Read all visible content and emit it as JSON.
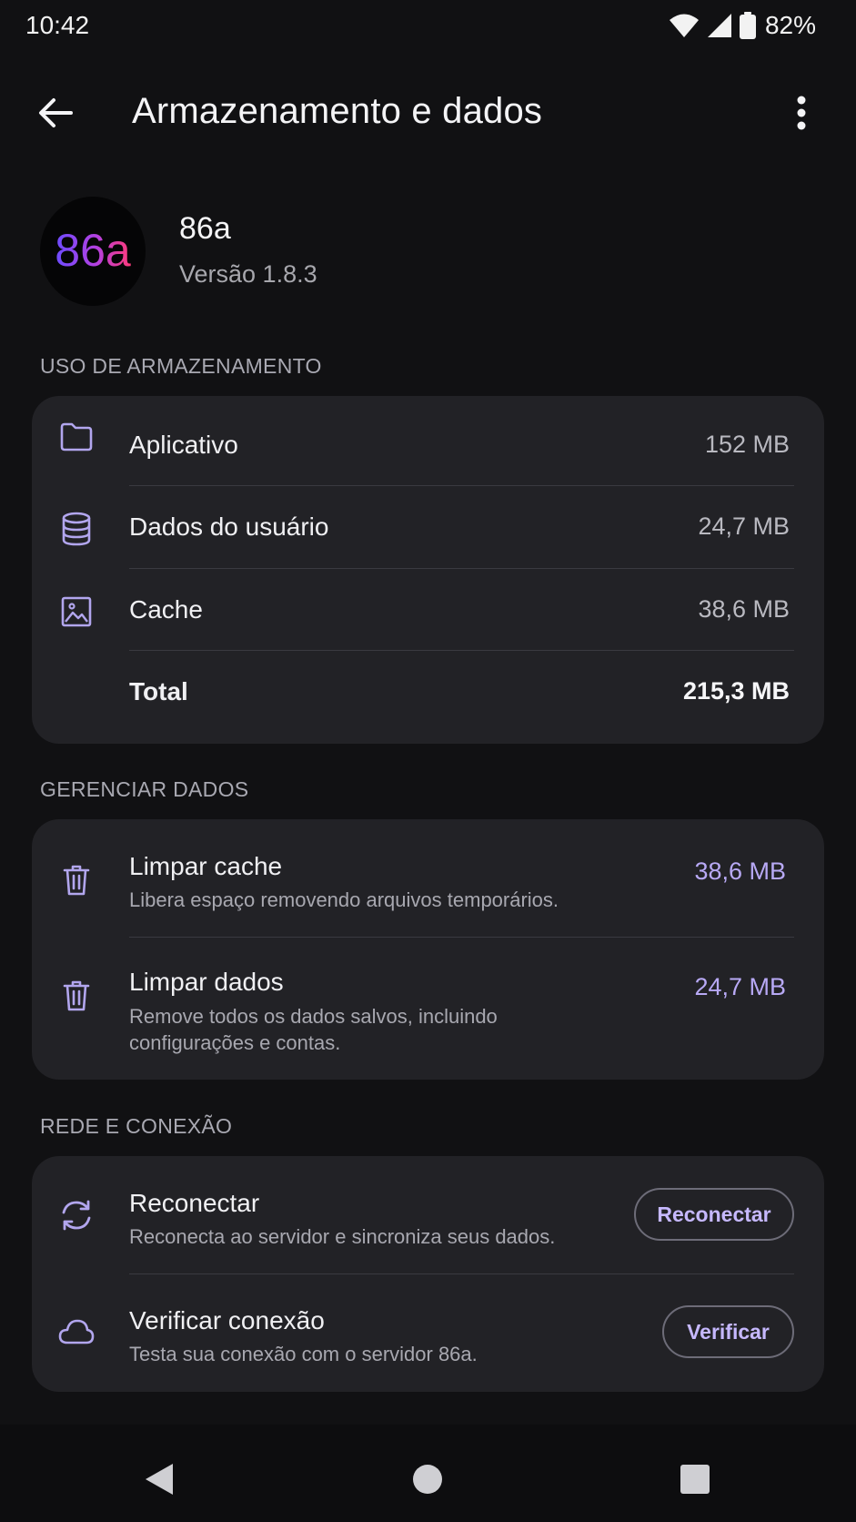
{
  "status": {
    "time": "10:42",
    "battery": "82%",
    "icons": [
      "wifi-icon",
      "signal-icon",
      "battery-icon"
    ]
  },
  "appbar": {
    "title": "Armazenamento e dados",
    "icons": [
      "back-arrow-icon",
      "more-vert-icon"
    ]
  },
  "app": {
    "logo_text": "86a",
    "name": "86a",
    "version": "Versão 1.8.3"
  },
  "storage": {
    "section": "USO DE ARMAZENAMENTO",
    "items": [
      {
        "icon": "folder-icon",
        "label": "Aplicativo",
        "value": "152 MB"
      },
      {
        "icon": "database-icon",
        "label": "Dados do usuário",
        "value": "24,7 MB"
      },
      {
        "icon": "image-icon",
        "label": "Cache",
        "value": "38,6 MB"
      }
    ],
    "total_label": "Total",
    "total_value": "215,3 MB"
  },
  "manage": {
    "section": "GERENCIAR DADOS",
    "items": [
      {
        "icon": "trash-icon",
        "title": "Limpar cache",
        "subtitle": "Libera espaço removendo arquivos temporários.",
        "value": "38,6 MB"
      },
      {
        "icon": "trash-icon",
        "title": "Limpar dados",
        "subtitle": "Remove todos os dados salvos, incluindo configurações e contas.",
        "value": "24,7 MB"
      }
    ]
  },
  "network": {
    "section": "REDE E CONEXÃO",
    "items": [
      {
        "icon": "sync-icon",
        "title": "Reconectar",
        "subtitle": "Reconecta ao servidor e sincroniza seus dados.",
        "button": "Reconectar"
      },
      {
        "icon": "cloud-icon",
        "title": "Verificar conexão",
        "subtitle": "Testa sua conexão com o servidor 86a.",
        "button": "Verificar"
      }
    ]
  },
  "colors": {
    "background": "#111113",
    "card": "#222226",
    "accent": "#b8a9f5",
    "icon": "#b2a6ee"
  },
  "navbar": {
    "icons": [
      "nav-back-icon",
      "nav-home-icon",
      "nav-recents-icon"
    ]
  }
}
